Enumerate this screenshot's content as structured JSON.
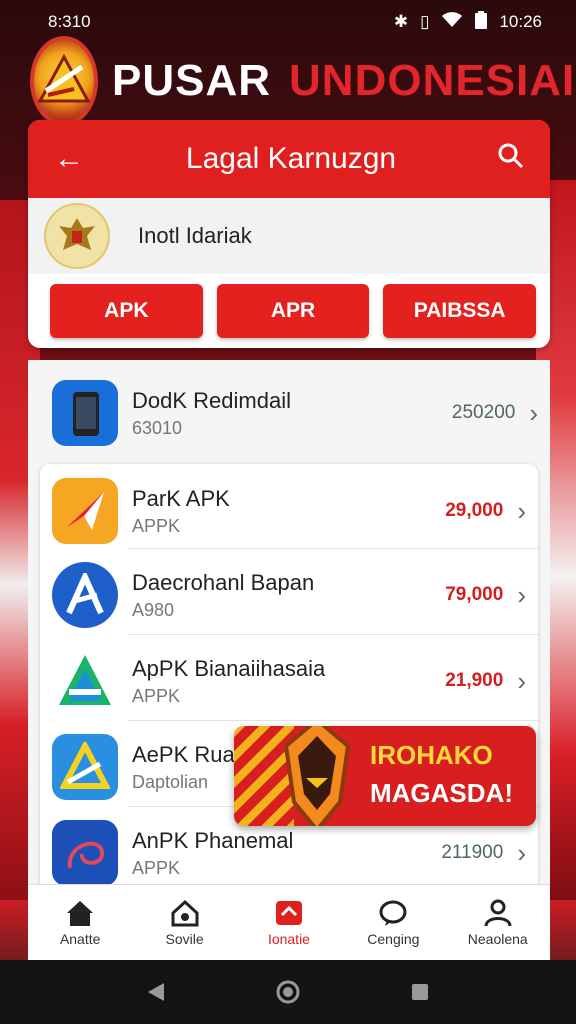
{
  "status_bar": {
    "time": "8:310",
    "clock": "10:26"
  },
  "brand": {
    "white": "PUSAR",
    "red": "UNDONESIAI"
  },
  "appbar": {
    "title": "Lagal Karnuzgn"
  },
  "profile": {
    "name": "Inotl Idariak"
  },
  "chips": [
    "APK",
    "APR",
    "PAIBSSA"
  ],
  "list": [
    {
      "title": "DodK Redimdail",
      "sub": "63010",
      "price": "250200"
    },
    {
      "title": "ParK APK",
      "sub": "APPK",
      "price": "29,000"
    },
    {
      "title": "Daecrohanl Bapan",
      "sub": "A980",
      "price": "79,000"
    },
    {
      "title": "ApPK Bianaiihasaia",
      "sub": "APPK",
      "price": "21,900"
    },
    {
      "title": "AePK Ruado",
      "sub": "Daptolian",
      "price": ""
    },
    {
      "title": "AnPK Phanemal",
      "sub": "APPK",
      "price": "211900"
    }
  ],
  "promo": {
    "line1": "IROHAKO",
    "line2": "MAGASDA!"
  },
  "bottom_nav": [
    "Anatte",
    "Sovile",
    "Ionatie",
    "Cenging",
    "Neaolena"
  ],
  "colors": {
    "accent": "#e0201f",
    "price": "#d41f1f"
  }
}
